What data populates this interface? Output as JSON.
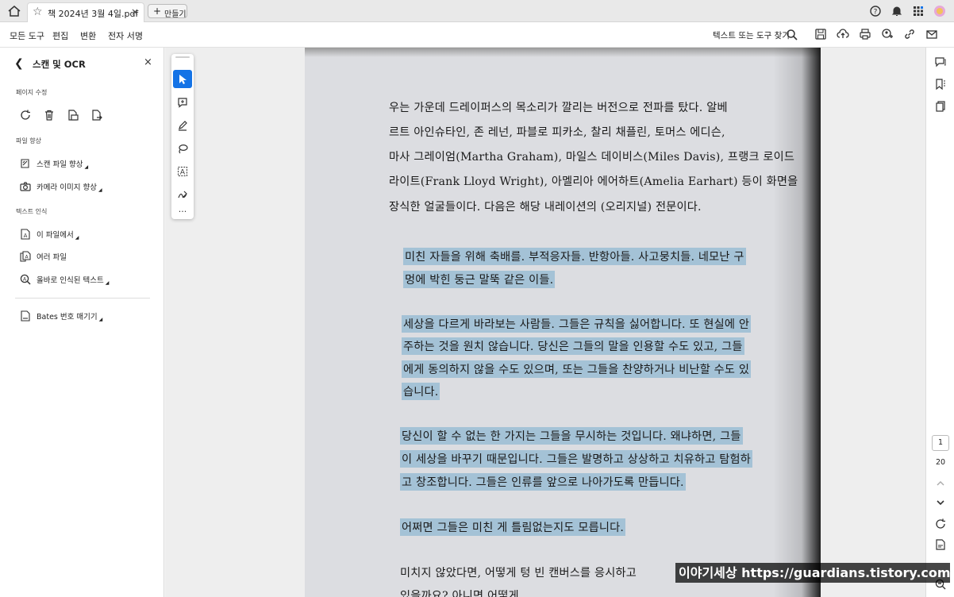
{
  "tab": {
    "title": "책 2024년 3월 4일.pdf",
    "close": "×",
    "new_tab_label": "만들기",
    "new_tab_plus": "+"
  },
  "menu": {
    "items": [
      "모든 도구",
      "편집",
      "변환",
      "전자 서명"
    ],
    "active": "변환",
    "search_label": "텍스트 또는 도구 찾기"
  },
  "sidepanel": {
    "title": "스캔 및 OCR",
    "close": "×",
    "sections": {
      "page_edit": "페이지 수정",
      "file_enhance": "파일 향상",
      "text_recognition": "텍스트 인식"
    },
    "enhance_items": [
      "스캔 파일 향상",
      "카메라 이미지 향상"
    ],
    "recognition_items": [
      "이 파일에서",
      "여러 파일",
      "올바로 인식된 텍스트"
    ],
    "bates": "Bates 번호 매기기"
  },
  "page_nav": {
    "current": "1",
    "total": "20"
  },
  "document": {
    "lines": [
      "우는 가운데 드레이퍼스의 목소리가 깔리는 버전으로 전파를 탔다. 알베",
      "르트 아인슈타인, 존 레넌, 파블로 피카소, 찰리 채플린, 토머스 에디슨,",
      "마사 그레이엄(Martha Graham), 마일스 데이비스(Miles Davis), 프랭크 로이드",
      "라이트(Frank Lloyd Wright), 아멜리아 에어하트(Amelia Earhart) 등이 화면을",
      "장식한 얼굴들이다. 다음은 해당 내레이션의 (오리지널) 전문이다."
    ],
    "highlighted": [
      "미친 자들을 위해 축배를. 부적응자들. 반항아들. 사고뭉치들. 네모난 구",
      "멍에 박힌 둥근 말뚝 같은 이들.",
      "세상을 다르게 바라보는 사람들. 그들은 규칙을 싫어합니다. 또 현실에 안",
      "주하는 것을 원치 않습니다. 당신은 그들의 말을 인용할 수도 있고, 그들",
      "에게 동의하지 않을 수도 있으며, 또는 그들을 찬양하거나 비난할 수도 있",
      "습니다.",
      "당신이 할 수 없는 한 가지는 그들을 무시하는 것입니다. 왜냐하면, 그들",
      "이 세상을 바꾸기 때문입니다. 그들은 발명하고 상상하고 치유하고 탐험하",
      "고 창조합니다. 그들은 인류를 앞으로 나아가도록 만듭니다.",
      "어쩌면 그들은 미친 게 틀림없는지도 모릅니다."
    ],
    "tail": [
      "미치지 않았다면, 어떻게 텅 빈 캔버스를 응시하고",
      "있을까요? 아니면 어떻게 ..."
    ]
  },
  "watermark": "이야기세상 https://guardians.tistory.com",
  "colors": {
    "accent": "#1473e6",
    "highlight": "#a4c2d6"
  },
  "icons": [
    "home-icon",
    "star-icon",
    "help-icon",
    "bell-icon",
    "apps-icon",
    "avatar",
    "search-icon",
    "save-icon",
    "upload-icon",
    "print-icon",
    "share-icon",
    "link-icon",
    "mail-icon",
    "back-icon",
    "rotate-icon",
    "trash-icon",
    "extract-icon",
    "replace-icon",
    "enhance-icon",
    "camera-icon",
    "ocr-icon",
    "multi-file-icon",
    "suspect-text-icon",
    "bates-icon",
    "pointer-icon",
    "comment-icon",
    "pen-icon",
    "lasso-icon",
    "text-select-icon",
    "sign-icon",
    "more-icon",
    "comment-panel-icon",
    "bookmark-icon",
    "pages-icon",
    "chevron-up-icon",
    "chevron-down-icon",
    "refresh-icon",
    "doc-icon",
    "zoom-icon"
  ]
}
